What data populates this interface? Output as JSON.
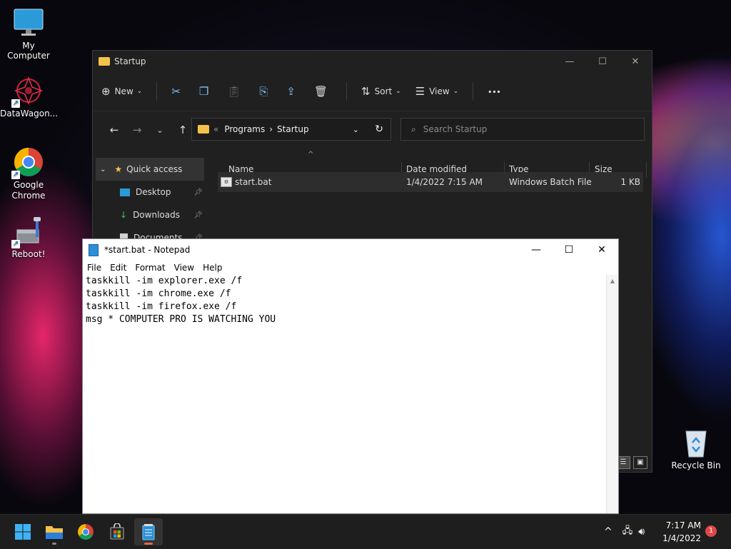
{
  "desktop": {
    "icons": [
      {
        "label": "My Computer"
      },
      {
        "label": "DataWagon..."
      },
      {
        "label": "Google Chrome"
      },
      {
        "label": "Reboot!"
      },
      {
        "label": "Recycle Bin"
      }
    ]
  },
  "explorer": {
    "title": "Startup",
    "toolbar": {
      "new": "New",
      "sort": "Sort",
      "view": "View",
      "more": "···"
    },
    "address": {
      "prefix": "«",
      "crumb1": "Programs",
      "sep": "›",
      "crumb2": "Startup"
    },
    "search_placeholder": "Search Startup",
    "sidebar": [
      {
        "label": "Quick access"
      },
      {
        "label": "Desktop"
      },
      {
        "label": "Downloads"
      },
      {
        "label": "Documents"
      }
    ],
    "columns": {
      "name": "Name",
      "date": "Date modified",
      "type": "Type",
      "size": "Size"
    },
    "files": [
      {
        "name": "start.bat",
        "date": "1/4/2022 7:15 AM",
        "type": "Windows Batch File",
        "size": "1 KB"
      }
    ]
  },
  "notepad": {
    "title": "*start.bat - Notepad",
    "menu": [
      "File",
      "Edit",
      "Format",
      "View",
      "Help"
    ],
    "content": "taskkill -im explorer.exe /f\ntaskkill -im chrome.exe /f\ntaskkill -im firefox.exe /f\nmsg * COMPUTER PRO IS WATCHING YOU"
  },
  "taskbar": {
    "time": "7:17 AM",
    "date": "1/4/2022",
    "notification_count": "1"
  },
  "colors": {
    "explorer_bg": "#202020",
    "folder_yellow": "#f4c24a",
    "accent_blue": "#7cc4ff",
    "taskbar_bg": "#1e1e1e",
    "badge_red": "#e04848"
  }
}
